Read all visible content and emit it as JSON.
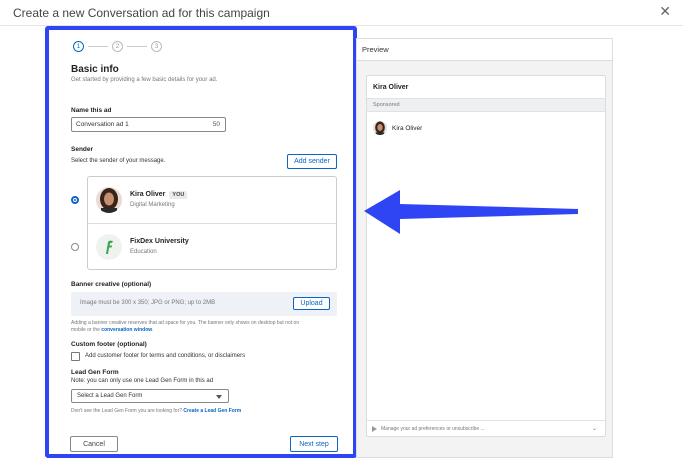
{
  "window": {
    "title": "Create a new Conversation ad for this campaign",
    "close_glyph": "✕"
  },
  "stepper": {
    "steps": [
      "1",
      "2",
      "3"
    ],
    "active": 1
  },
  "basic_info": {
    "title": "Basic info",
    "subtitle": "Get started by providing a few basic details for your ad."
  },
  "ad_name": {
    "label": "Name this ad",
    "value": "Conversation ad 1",
    "remaining": "50"
  },
  "sender": {
    "label": "Sender",
    "instruction": "Select the sender of your message.",
    "add_button": "Add sender",
    "options": [
      {
        "name": "Kira Oliver",
        "badge": "YOU",
        "subtitle": "Digital Marketing",
        "selected": true
      },
      {
        "name": "FixDex University",
        "badge": "",
        "subtitle": "Education",
        "selected": false
      }
    ]
  },
  "banner": {
    "label": "Banner creative (optional)",
    "placeholder": "Image must be 300 x 350; JPG or PNG; up to 2MB",
    "upload_button": "Upload",
    "help_line1": "Adding a banner creative reserves that ad space for you. The banner only shows on desktop but not on",
    "help_line2_prefix": "mobile or the ",
    "help_link": "conversation window",
    "help_line2_suffix": "."
  },
  "custom_footer": {
    "label": "Custom footer (optional)",
    "checkbox_label": "Add customer footer for terms and conditions, or disclaimers",
    "checked": false
  },
  "lead_gen": {
    "label": "Lead Gen Form",
    "note": "Note: you can only use one Lead Gen Form in this ad",
    "select_value": "Select a Lead Gen Form",
    "help_prefix": "Don't see the Lead Gen Form you are looking for? ",
    "help_link": "Create a Lead Gen Form"
  },
  "footer_buttons": {
    "cancel": "Cancel",
    "next": "Next step"
  },
  "preview": {
    "title": "Preview",
    "card_name": "Kira Oliver",
    "sponsored": "Sponsored",
    "sender": "Kira Oliver",
    "footer_text": "Manage your ad preferences or unsubscribe ...",
    "footer_chevron": "⌄"
  },
  "colors": {
    "highlight_border": "#2f45f3",
    "arrow": "#2f45f3",
    "link_blue": "#0a66c2",
    "primary_button": "#0a66c2"
  }
}
